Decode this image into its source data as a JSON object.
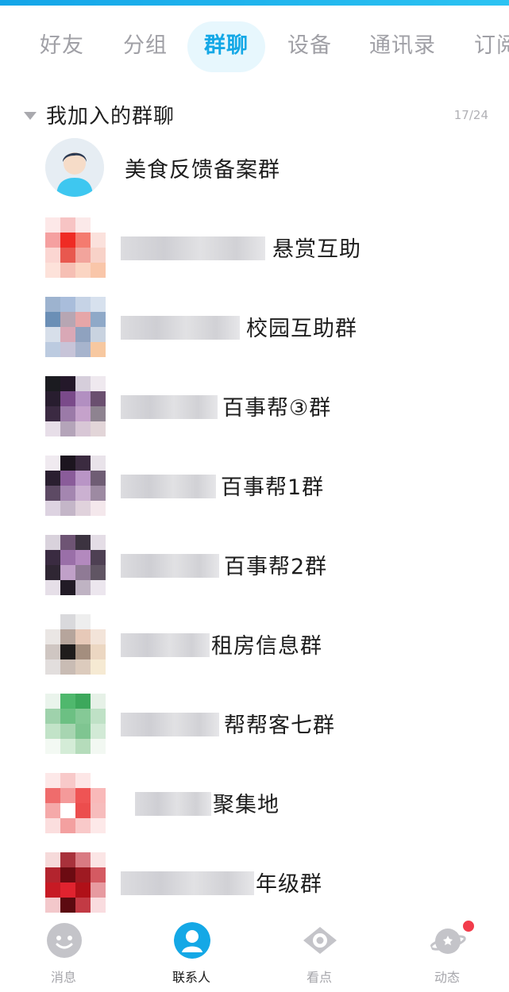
{
  "tabs": [
    "好友",
    "分组",
    "群聊",
    "设备",
    "通讯录",
    "订阅"
  ],
  "active_tab": "群聊",
  "group": {
    "title": "我加入的群聊",
    "count": "17/24"
  },
  "groups": [
    {
      "name": "美食反馈备案群"
    },
    {
      "name": "悬赏互助"
    },
    {
      "name": "校园互助群"
    },
    {
      "name": "百事帮③群"
    },
    {
      "name": "百事帮1群"
    },
    {
      "name": "百事帮2群"
    },
    {
      "name": "租房信息群"
    },
    {
      "name": "帮帮客七群"
    },
    {
      "name": "聚集地"
    },
    {
      "name": "年级群"
    }
  ],
  "bottom_nav": [
    "消息",
    "联系人",
    "看点",
    "动态"
  ],
  "colors": {
    "accent": "#14a8e6",
    "badge": "#f23c4b"
  }
}
